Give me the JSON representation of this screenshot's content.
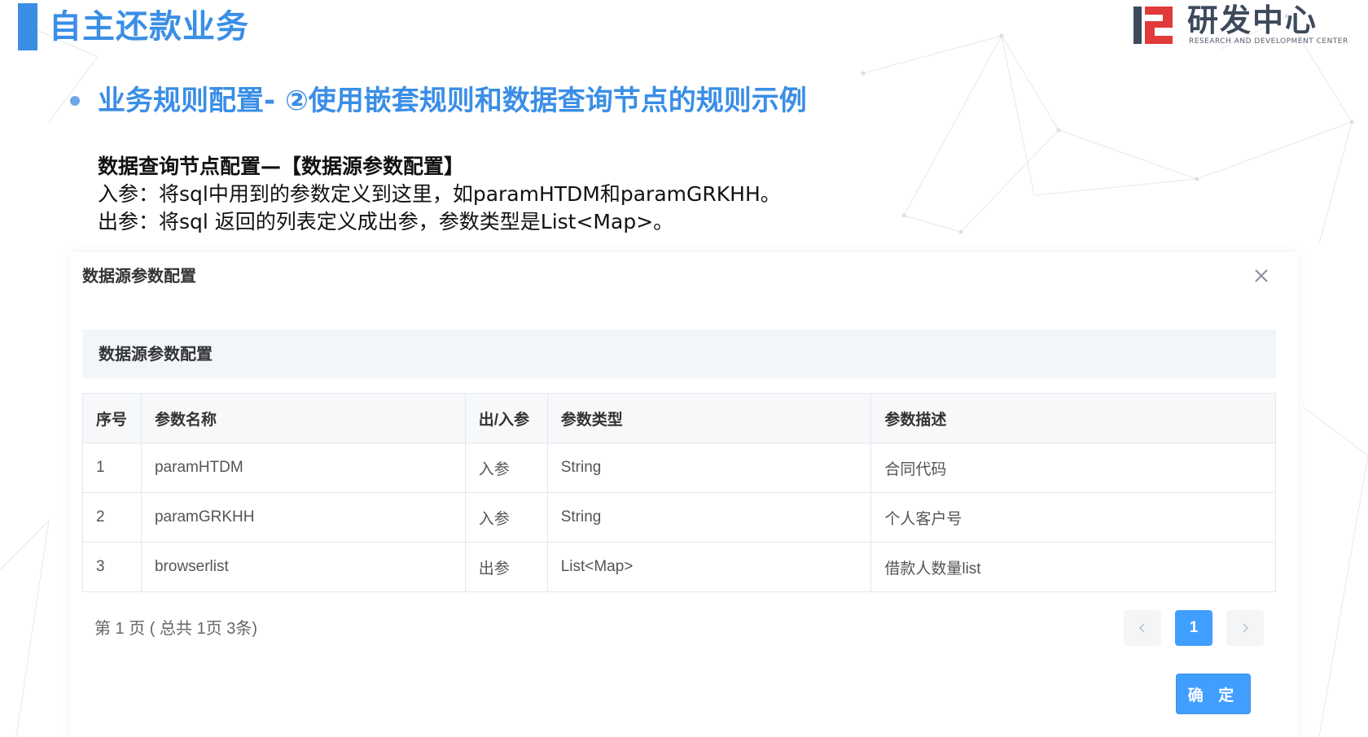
{
  "slide": {
    "title": "自主还款业务",
    "subtitle": "业务规则配置- ②使用嵌套规则和数据查询节点的规则示例",
    "logo": {
      "cn": "研发中心",
      "en": "RESEARCH AND DEVELOPMENT CENTER",
      "accent_color": "#e03a3a",
      "mark_color": "#3d4a5c"
    },
    "description": {
      "heading": "数据查询节点配置—【数据源参数配置】",
      "line1": "入参：将sql中用到的参数定义到这里，如paramHTDM和paramGRKHH。",
      "line2": "出参：将sql 返回的列表定义成出参，参数类型是List<Map>。"
    },
    "accent_color": "#3a8ee6"
  },
  "dialog": {
    "title": "数据源参数配置",
    "close_icon": "close-icon",
    "section_title": "数据源参数配置",
    "table": {
      "headers": [
        "序号",
        "参数名称",
        "出/入参",
        "参数类型",
        "参数描述"
      ],
      "rows": [
        [
          "1",
          "paramHTDM",
          "入参",
          "String",
          "合同代码"
        ],
        [
          "2",
          "paramGRKHH",
          "入参",
          "String",
          "个人客户号"
        ],
        [
          "3",
          "browserlist",
          "出参",
          "List<Map>",
          "借款人数量list"
        ]
      ]
    },
    "pagination": {
      "info": "第 1 页 ( 总共 1页 3条)",
      "prev_icon": "chevron-left-icon",
      "current_page": "1",
      "next_icon": "chevron-right-icon"
    },
    "confirm_label": "确 定",
    "primary_color": "#409eff"
  }
}
